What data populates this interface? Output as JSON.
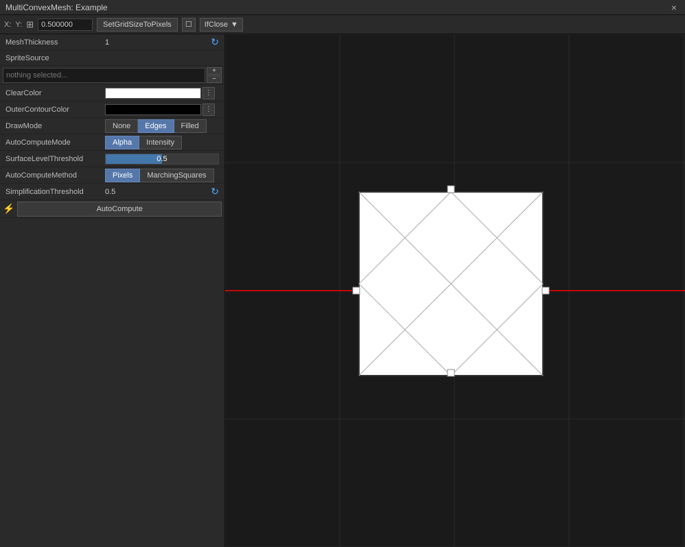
{
  "window": {
    "title": "MultiConvexMesh: Example",
    "close_label": "×"
  },
  "toolbar": {
    "x_label": "X:",
    "y_label": "Y:",
    "grid_value": "0.500000",
    "set_grid_btn": "SetGridSizeToPixels",
    "if_close_btn": "IfClose",
    "grid_icon": "⊞"
  },
  "panel": {
    "mesh_thickness_label": "MeshThickness",
    "mesh_thickness_value": "1",
    "sprite_source_label": "SpriteSource",
    "sprite_source_placeholder": "nothing selected...",
    "clear_color_label": "ClearColor",
    "outer_contour_label": "OuterContourColor",
    "draw_mode_label": "DrawMode",
    "draw_mode_none": "None",
    "draw_mode_edges": "Edges",
    "draw_mode_filled": "Filled",
    "auto_compute_mode_label": "AutoComputeMode",
    "auto_compute_alpha": "Alpha",
    "auto_compute_intensity": "Intensity",
    "surface_level_label": "SurfaceLevelThreshold",
    "surface_level_value": "0.5",
    "auto_compute_method_label": "AutoComputeMethod",
    "pixels_btn": "Pixels",
    "marching_btn": "MarchingSquares",
    "simplification_label": "SimplificationThreshold",
    "simplification_value": "0.5",
    "autocompute_label": "AutoCompute",
    "lightning_symbol": "⚡"
  }
}
